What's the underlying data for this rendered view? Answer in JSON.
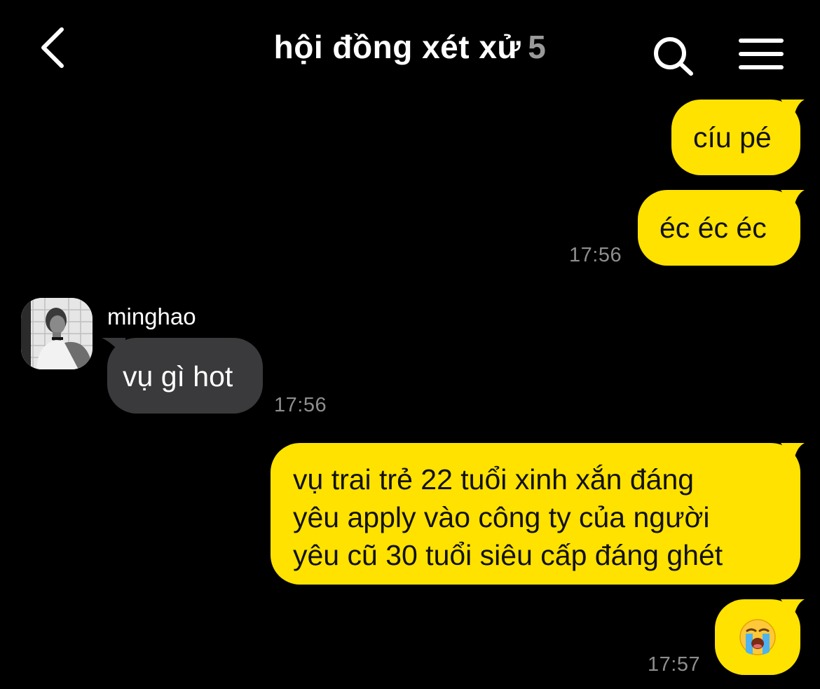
{
  "header": {
    "title": "hội đồng xét xử",
    "member_count": "5",
    "back_icon": "chevron-left-icon",
    "search_icon": "search-icon",
    "menu_icon": "hamburger-menu-icon"
  },
  "messages": [
    {
      "direction": "out",
      "text": "cíu pé"
    },
    {
      "direction": "out",
      "text": "éc éc éc",
      "time": "17:56"
    },
    {
      "direction": "in",
      "sender": "minghao",
      "text": "vụ gì hot",
      "time": "17:56"
    },
    {
      "direction": "out",
      "lines": [
        "vụ trai trẻ 22 tuổi xinh xắn đáng",
        "yêu apply vào công ty của người",
        "yêu cũ 30 tuổi siêu cấp đáng ghét"
      ]
    },
    {
      "direction": "out",
      "emoji": "😭",
      "time": "17:57"
    }
  ],
  "colors": {
    "background": "#000000",
    "outgoing_bubble": "#ffe200",
    "incoming_bubble": "#3a3a3c",
    "timestamp": "#8e8e8e",
    "member_count": "#9a9a9a"
  }
}
